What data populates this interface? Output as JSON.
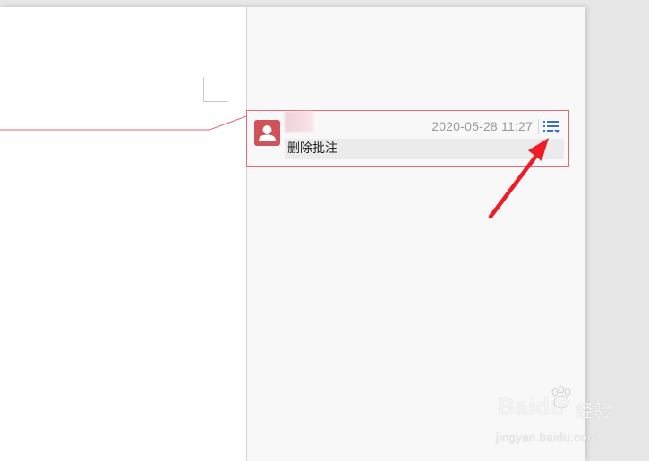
{
  "comment": {
    "author": "",
    "timestamp": "2020-05-28 11:27",
    "text": "删除批注",
    "menu_icon": "list-menu-icon",
    "avatar_icon": "user-avatar-icon"
  },
  "colors": {
    "comment_border": "#e06b72",
    "avatar_bg": "#cf5357",
    "menu_icon": "#3d6fbf",
    "annotation_arrow": "#ee1c24",
    "pane_bg": "#f8f8f9"
  },
  "watermark": {
    "logo": "Baidu",
    "cn": "经验",
    "url": "jingyan.baidu.com"
  }
}
